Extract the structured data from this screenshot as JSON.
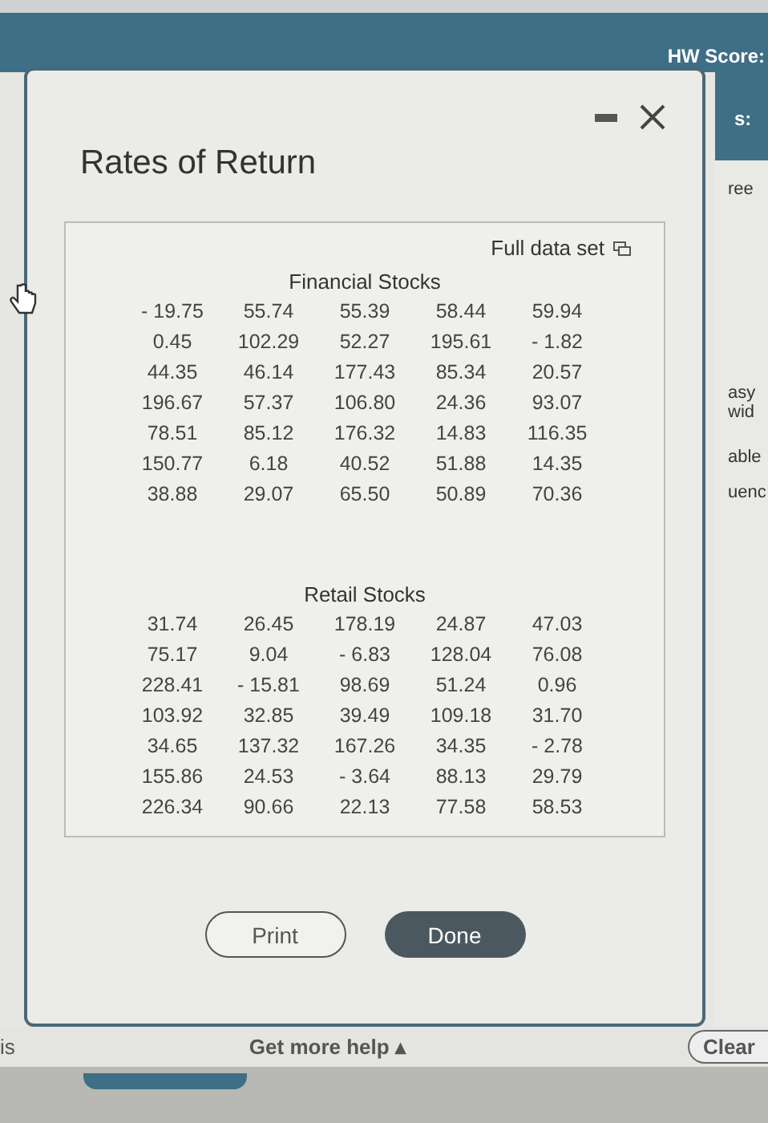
{
  "background": {
    "score_label": "HW Score:",
    "side_label": "s:",
    "side_texts": [
      "ree",
      "asy",
      "wid",
      "able",
      "uenc"
    ],
    "bottom_left": "is",
    "help_link": "Get more help ▴",
    "clear_button": "Clear"
  },
  "dialog": {
    "title": "Rates of Return",
    "full_data_set": "Full data set",
    "tables": [
      {
        "title": "Financial Stocks",
        "rows": [
          [
            "- 19.75",
            "55.74",
            "55.39",
            "58.44",
            "59.94"
          ],
          [
            "0.45",
            "102.29",
            "52.27",
            "195.61",
            "- 1.82"
          ],
          [
            "44.35",
            "46.14",
            "177.43",
            "85.34",
            "20.57"
          ],
          [
            "196.67",
            "57.37",
            "106.80",
            "24.36",
            "93.07"
          ],
          [
            "78.51",
            "85.12",
            "176.32",
            "14.83",
            "116.35"
          ],
          [
            "150.77",
            "6.18",
            "40.52",
            "51.88",
            "14.35"
          ],
          [
            "38.88",
            "29.07",
            "65.50",
            "50.89",
            "70.36"
          ]
        ]
      },
      {
        "title": "Retail Stocks",
        "rows": [
          [
            "31.74",
            "26.45",
            "178.19",
            "24.87",
            "47.03"
          ],
          [
            "75.17",
            "9.04",
            "- 6.83",
            "128.04",
            "76.08"
          ],
          [
            "228.41",
            "- 15.81",
            "98.69",
            "51.24",
            "0.96"
          ],
          [
            "103.92",
            "32.85",
            "39.49",
            "109.18",
            "31.70"
          ],
          [
            "34.65",
            "137.32",
            "167.26",
            "34.35",
            "- 2.78"
          ],
          [
            "155.86",
            "24.53",
            "- 3.64",
            "88.13",
            "29.79"
          ],
          [
            "226.34",
            "90.66",
            "22.13",
            "77.58",
            "58.53"
          ]
        ]
      }
    ],
    "buttons": [
      {
        "label": "Print",
        "kind": "outline"
      },
      {
        "label": "Done",
        "kind": "primary"
      }
    ]
  }
}
